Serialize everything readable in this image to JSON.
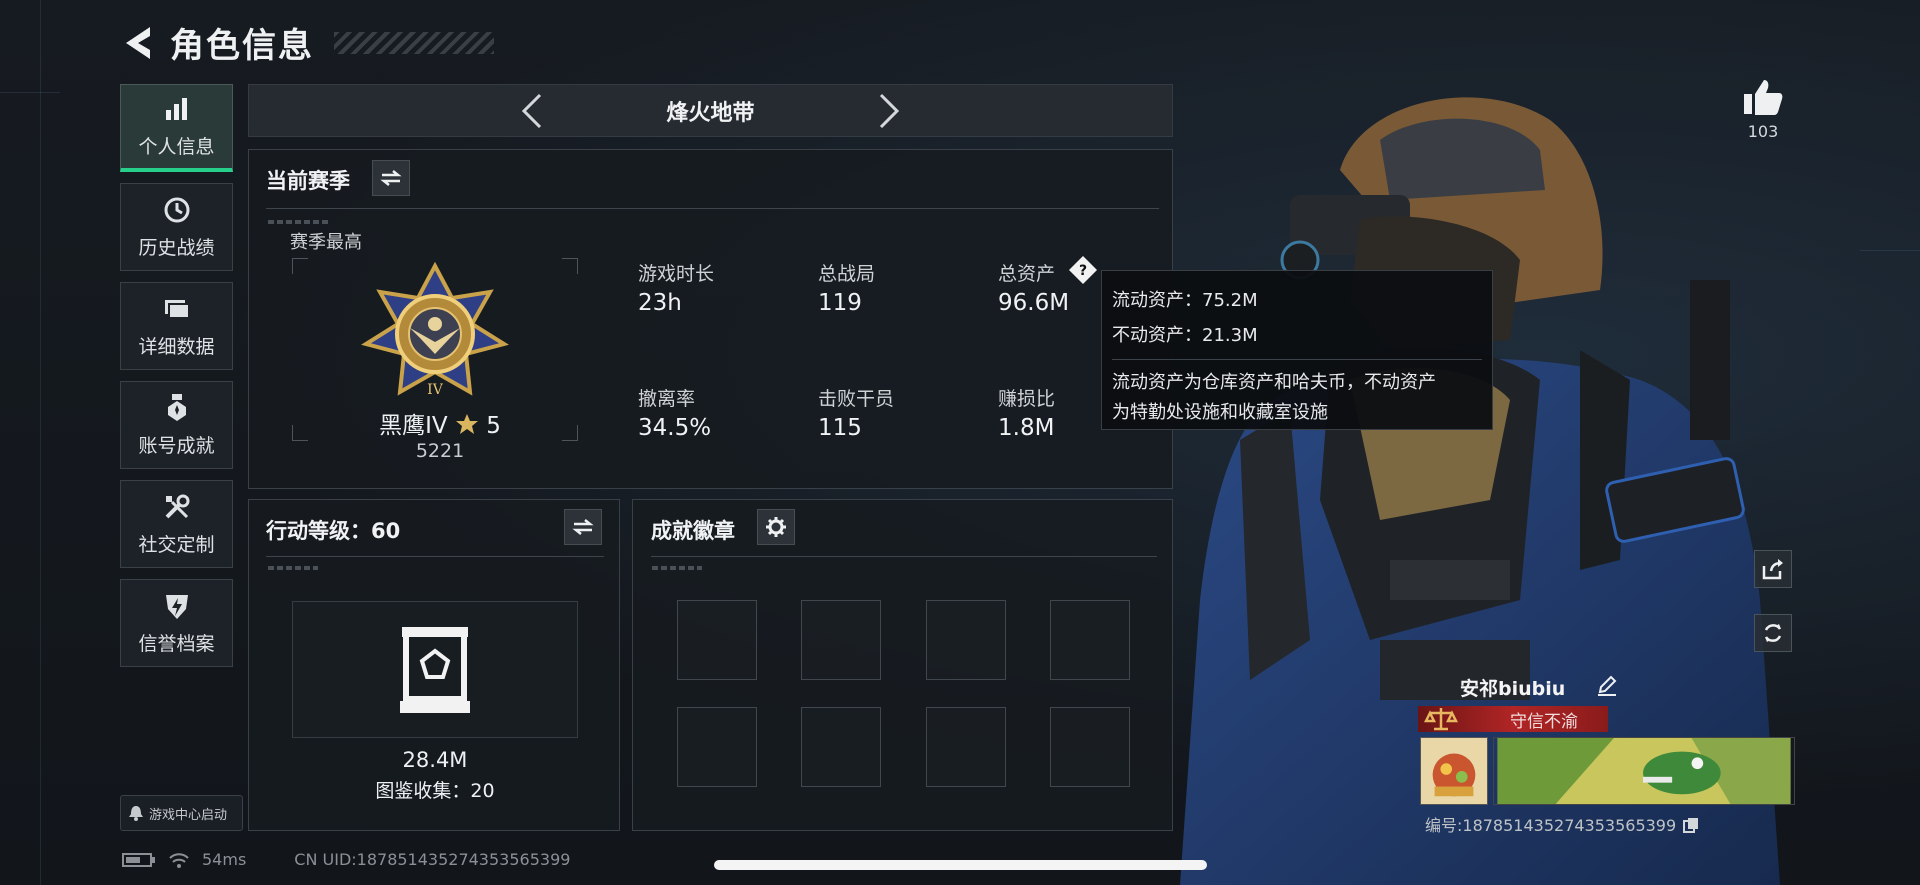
{
  "header": {
    "title": "角色信息"
  },
  "sidebar": {
    "items": [
      {
        "label": "个人信息",
        "icon": "bar-chart-icon",
        "active": true
      },
      {
        "label": "历史战绩",
        "icon": "history-clock-icon",
        "active": false
      },
      {
        "label": "详细数据",
        "icon": "folder-icon",
        "active": false
      },
      {
        "label": "账号成就",
        "icon": "medal-icon",
        "active": false
      },
      {
        "label": "社交定制",
        "icon": "wrench-screwdriver-icon",
        "active": false
      },
      {
        "label": "信誉档案",
        "icon": "shield-lightning-icon",
        "active": false
      }
    ],
    "launch": "游戏中心启动"
  },
  "season_nav": {
    "name": "烽火地带"
  },
  "current_season": {
    "title": "当前赛季",
    "best_label": "赛季最高",
    "rank": {
      "name": "黑鹰IV",
      "stars": "5",
      "score": "5221"
    },
    "stats": [
      {
        "label": "游戏时长",
        "value": "23h"
      },
      {
        "label": "总战局",
        "value": "119"
      },
      {
        "label": "总资产",
        "value": "96.6M"
      },
      {
        "label": "撤离率",
        "value": "34.5%"
      },
      {
        "label": "击败干员",
        "value": "115"
      },
      {
        "label": "赚损比",
        "value": "1.8M"
      }
    ]
  },
  "tooltip": {
    "liquid": "流动资产：75.2M",
    "fixed": "不动资产：21.3M",
    "desc_1": "流动资产为仓库资产和哈夫币，不动资产",
    "desc_2": "为特勤处设施和收藏室设施"
  },
  "action_level": {
    "title": "行动等级：60",
    "value": "28.4M",
    "collection": "图鉴收集：20"
  },
  "achievements": {
    "title": "成就徽章",
    "slot_count": 8
  },
  "likes": {
    "count": "103"
  },
  "player": {
    "name": "安祁biubiu",
    "title_badge": "守信不渝",
    "id": "编号:1878514352743535653​99"
  },
  "status_bar": {
    "ping": "54ms",
    "uid": "CN UID:187851435274353565399"
  },
  "colors": {
    "accent_green": "#27d08a",
    "title_badge_red": "#b12525"
  }
}
